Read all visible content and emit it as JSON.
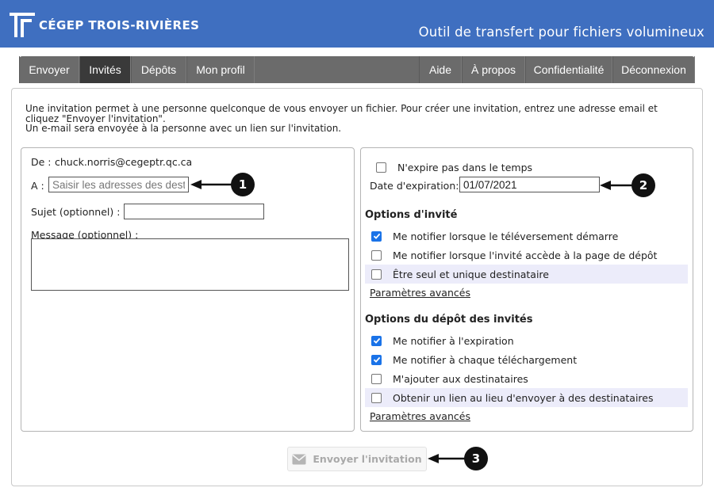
{
  "header": {
    "brand": "CÉGEP TROIS-RIVIÈRES",
    "app_title": "Outil de transfert pour fichiers volumineux",
    "color": "#3f6fc0"
  },
  "nav": {
    "left_tabs": [
      {
        "label": "Envoyer"
      },
      {
        "label": "Invités",
        "active": true
      },
      {
        "label": "Dépôts"
      },
      {
        "label": "Mon profil"
      }
    ],
    "right_tabs": [
      {
        "label": "Aide"
      },
      {
        "label": "À propos"
      },
      {
        "label": "Confidentialité"
      },
      {
        "label": "Déconnexion"
      }
    ]
  },
  "intro": {
    "line1": "Une invitation permet à une personne quelconque de vous envoyer un fichier. Pour créer une invitation, entrez une adresse email et cliquez \"Envoyer l'invitation\".",
    "line2": "Un e-mail sera envoyée à la personne avec un lien sur l'invitation."
  },
  "form": {
    "from_label": "De :",
    "from_value": "chuck.norris@cegeptr.qc.ca",
    "to_label": "A :",
    "to_placeholder": "Saisir les adresses des destinataires",
    "subject_label": "Sujet (optionnel) :",
    "subject_value": "",
    "message_label": "Message (optionnel) :",
    "message_value": ""
  },
  "expiry": {
    "never_label": "N'expire pas dans le temps",
    "never_checked": false,
    "date_label": "Date d'expiration:",
    "date_value": "01/07/2021"
  },
  "guest_options": {
    "title": "Options d'invité",
    "items": [
      {
        "label": "Me notifier lorsque le téléversement démarre",
        "checked": true
      },
      {
        "label": "Me notifier lorsque l'invité accède à la page de dépôt",
        "checked": false
      },
      {
        "label": "Être seul et unique destinataire",
        "checked": false,
        "highlight": true
      }
    ],
    "advanced": "Paramètres avancés"
  },
  "upload_options": {
    "title": "Options du dépôt des invités",
    "items": [
      {
        "label": "Me notifier à l'expiration",
        "checked": true
      },
      {
        "label": "Me notifier à chaque téléchargement",
        "checked": true
      },
      {
        "label": "M'ajouter aux destinataires",
        "checked": false
      },
      {
        "label": "Obtenir un lien au lieu d'envoyer à des destinataires",
        "checked": false,
        "highlight": true
      }
    ],
    "advanced": "Paramètres avancés"
  },
  "send_button": {
    "label": "Envoyer l'invitation",
    "icon": "envelope-icon"
  },
  "callouts": [
    "1",
    "2",
    "3"
  ]
}
